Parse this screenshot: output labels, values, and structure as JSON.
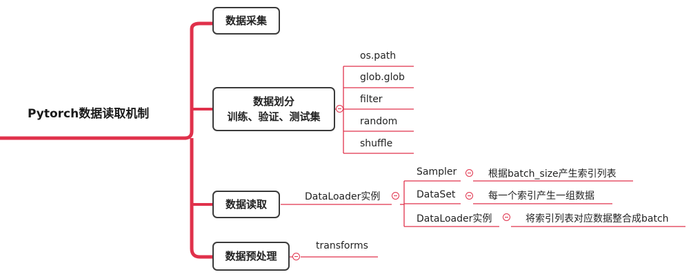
{
  "root": {
    "label": "Pytorch数据读取机制"
  },
  "branches": [
    {
      "label": "数据采集"
    },
    {
      "label_line1": "数据划分",
      "label_line2": "训练、验证、测试集",
      "children": [
        "os.path",
        "glob.glob",
        "filter",
        "random",
        "shuffle"
      ]
    },
    {
      "label": "数据读取",
      "child": "DataLoader实例",
      "grandchildren": [
        {
          "label": "Sampler",
          "note": "根据batch_size产生索引列表"
        },
        {
          "label": "DataSet",
          "note": "每一个索引产生一组数据"
        },
        {
          "label": "DataLoader实例",
          "note": "将索引列表对应数据整合成batch"
        }
      ]
    },
    {
      "label": "数据预处理",
      "child": "transforms"
    }
  ],
  "colors": {
    "branch": "#e0314b",
    "box_border": "#3a3a3a",
    "text": "#222222"
  }
}
